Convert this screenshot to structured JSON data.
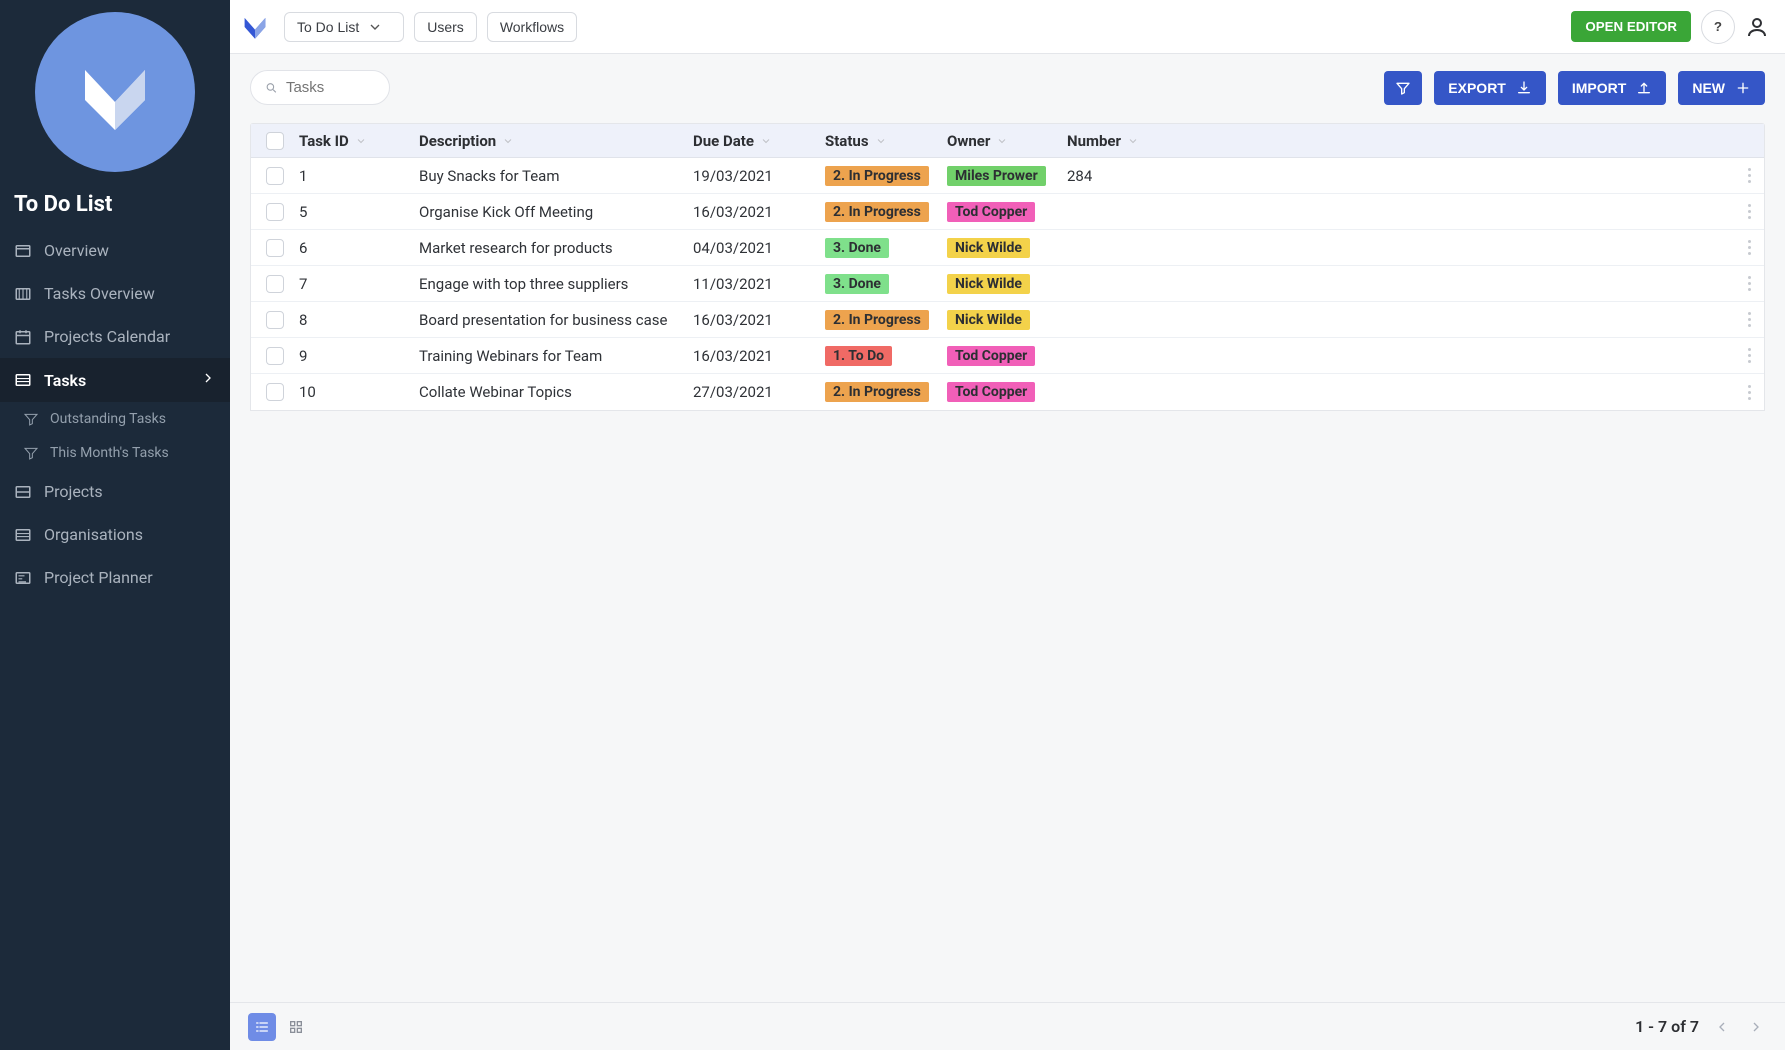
{
  "sidebar": {
    "title": "To Do List",
    "items": [
      {
        "label": "Overview",
        "active": false
      },
      {
        "label": "Tasks Overview",
        "active": false
      },
      {
        "label": "Projects Calendar",
        "active": false
      },
      {
        "label": "Tasks",
        "active": true,
        "children": [
          {
            "label": "Outstanding Tasks"
          },
          {
            "label": "This Month's Tasks"
          }
        ]
      },
      {
        "label": "Projects",
        "active": false
      },
      {
        "label": "Organisations",
        "active": false
      },
      {
        "label": "Project Planner",
        "active": false
      }
    ]
  },
  "topbar": {
    "context_label": "To Do List",
    "users_label": "Users",
    "workflows_label": "Workflows",
    "open_editor_label": "OPEN EDITOR",
    "help_label": "?"
  },
  "toolbar": {
    "search_placeholder": "Tasks",
    "export_label": "EXPORT",
    "import_label": "IMPORT",
    "new_label": "NEW"
  },
  "status_colors": {
    "1. To Do": "#f06a65",
    "2. In Progress": "#eda34e",
    "3. Done": "#7fe08b"
  },
  "owner_colors": {
    "Miles Prower": "#71d06a",
    "Tod Copper": "#f15fb8",
    "Nick Wilde": "#f3d24a"
  },
  "table": {
    "columns": [
      "Task ID",
      "Description",
      "Due Date",
      "Status",
      "Owner",
      "Number"
    ],
    "rows": [
      {
        "id": "1",
        "desc": "Buy Snacks for Team",
        "due": "19/03/2021",
        "status": "2. In Progress",
        "owner": "Miles Prower",
        "number": "284"
      },
      {
        "id": "5",
        "desc": "Organise Kick Off Meeting",
        "due": "16/03/2021",
        "status": "2. In Progress",
        "owner": "Tod Copper",
        "number": ""
      },
      {
        "id": "6",
        "desc": "Market research for products",
        "due": "04/03/2021",
        "status": "3. Done",
        "owner": "Nick Wilde",
        "number": ""
      },
      {
        "id": "7",
        "desc": "Engage with top three suppliers",
        "due": "11/03/2021",
        "status": "3. Done",
        "owner": "Nick Wilde",
        "number": ""
      },
      {
        "id": "8",
        "desc": "Board presentation for business case",
        "due": "16/03/2021",
        "status": "2. In Progress",
        "owner": "Nick Wilde",
        "number": ""
      },
      {
        "id": "9",
        "desc": "Training Webinars for Team",
        "due": "16/03/2021",
        "status": "1. To Do",
        "owner": "Tod Copper",
        "number": ""
      },
      {
        "id": "10",
        "desc": "Collate Webinar Topics",
        "due": "27/03/2021",
        "status": "2. In Progress",
        "owner": "Tod Copper",
        "number": ""
      }
    ]
  },
  "footer": {
    "range_label": "1 - 7 of 7"
  }
}
